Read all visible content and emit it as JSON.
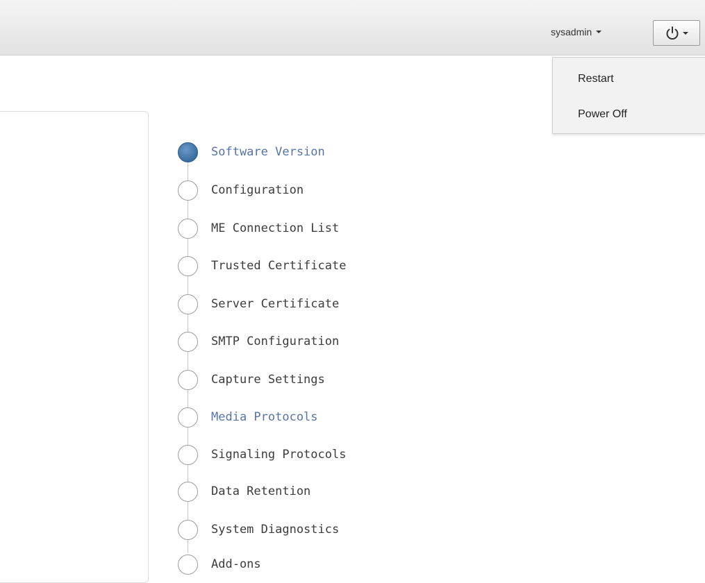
{
  "header": {
    "username": "sysadmin",
    "power_menu": {
      "items": [
        {
          "label": "Restart"
        },
        {
          "label": "Power Off"
        }
      ]
    }
  },
  "wizard": {
    "steps": [
      {
        "label": "Software Version",
        "state": "active"
      },
      {
        "label": "Configuration",
        "state": "pending"
      },
      {
        "label": "ME Connection List",
        "state": "pending"
      },
      {
        "label": "Trusted Certificate",
        "state": "pending"
      },
      {
        "label": "Server Certificate",
        "state": "pending"
      },
      {
        "label": "SMTP Configuration",
        "state": "pending"
      },
      {
        "label": "Capture Settings",
        "state": "pending"
      },
      {
        "label": "Media Protocols",
        "state": "highlighted"
      },
      {
        "label": "Signaling Protocols",
        "state": "pending"
      },
      {
        "label": "Data Retention",
        "state": "pending"
      },
      {
        "label": "System Diagnostics",
        "state": "pending"
      },
      {
        "label": "Add-ons",
        "state": "pending"
      }
    ]
  },
  "colors": {
    "active_step": "#3a6e9f",
    "link_blue": "#5673a8",
    "text": "#3c3c3c"
  }
}
